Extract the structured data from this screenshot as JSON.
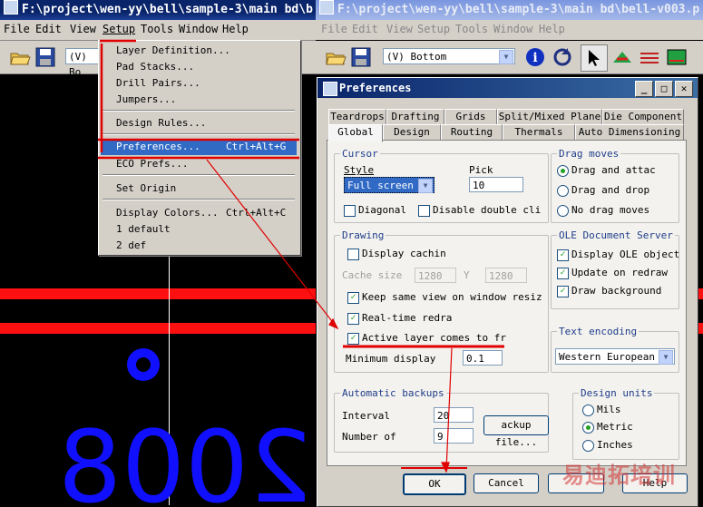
{
  "left_window": {
    "title": "F:\\project\\wen-yy\\bell\\sample-3\\main bd\\b",
    "menu": [
      "File",
      "Edit",
      "View",
      "Setup",
      "Tools",
      "Window",
      "Help"
    ],
    "toolbar_select": "(V) Bo"
  },
  "setup_menu": {
    "items": [
      {
        "label": "Layer Definition...",
        "shortcut": ""
      },
      {
        "label": "Pad Stacks...",
        "shortcut": ""
      },
      {
        "label": "Drill Pairs...",
        "shortcut": ""
      },
      {
        "label": "Jumpers...",
        "shortcut": ""
      },
      {
        "label": "Design Rules...",
        "shortcut": ""
      },
      {
        "label": "Preferences...",
        "shortcut": "Ctrl+Alt+G"
      },
      {
        "label": "ECO Prefs...",
        "shortcut": ""
      },
      {
        "label": "Set Origin",
        "shortcut": ""
      },
      {
        "label": "Display Colors...",
        "shortcut": "Ctrl+Alt+C"
      },
      {
        "label": "1 default",
        "shortcut": ""
      },
      {
        "label": "2 def",
        "shortcut": ""
      }
    ]
  },
  "canvas": {
    "text": "2008"
  },
  "right_window": {
    "title": "F:\\project\\wen-yy\\bell\\sample-3\\main bd\\bell-v003.p",
    "menu": [
      "File",
      "Edit",
      "View",
      "Setup",
      "Tools",
      "Window",
      "Help"
    ],
    "toolbar_select": "(V) Bottom"
  },
  "dialog": {
    "title": "Preferences",
    "tabs_row1": [
      "Teardrops",
      "Drafting",
      "Grids",
      "Split/Mixed Plane",
      "Die Component"
    ],
    "tabs_row2": [
      "Global",
      "Design",
      "Routing",
      "Thermals",
      "Auto Dimensioning"
    ],
    "cursor": {
      "title": "Cursor",
      "style_label": "Style",
      "style_value": "Full screen",
      "pick_label": "Pick",
      "pick_value": "10",
      "diagonal": "Diagonal",
      "disable_double": "Disable double cli"
    },
    "drag": {
      "title": "Drag moves",
      "attach": "Drag and attac",
      "drop": "Drag and drop",
      "no_drag": "No drag moves"
    },
    "drawing": {
      "title": "Drawing",
      "display_caching": "Display cachin",
      "cache_size": "Cache size",
      "cache_x": "1280",
      "y_label": "Y",
      "cache_y": "1280",
      "keep_same": "Keep same view on window resiz",
      "realtime": "Real-time redra",
      "active_layer": "Active layer comes to fr",
      "min_display": "Minimum display",
      "min_value": "0.1"
    },
    "ole": {
      "title": "OLE Document Server",
      "display_ole": "Display OLE object",
      "update_redraw": "Update on redraw",
      "draw_bg": "Draw background"
    },
    "encoding": {
      "title": "Text encoding",
      "value": "Western European"
    },
    "backups": {
      "title": "Automatic backups",
      "interval_label": "Interval",
      "interval_value": "20",
      "number_label": "Number of",
      "number_value": "9",
      "backup_file": "ackup file..."
    },
    "units": {
      "title": "Design units",
      "mils": "Mils",
      "metric": "Metric",
      "inches": "Inches"
    },
    "buttons": {
      "ok": "OK",
      "cancel": "Cancel",
      "help": "Help"
    }
  },
  "watermark": "易迪拓培训",
  "colors": {
    "highlight": "#316ac5",
    "annotation": "#e00000",
    "trace": "#ff1010",
    "pad": "#1010ff"
  }
}
